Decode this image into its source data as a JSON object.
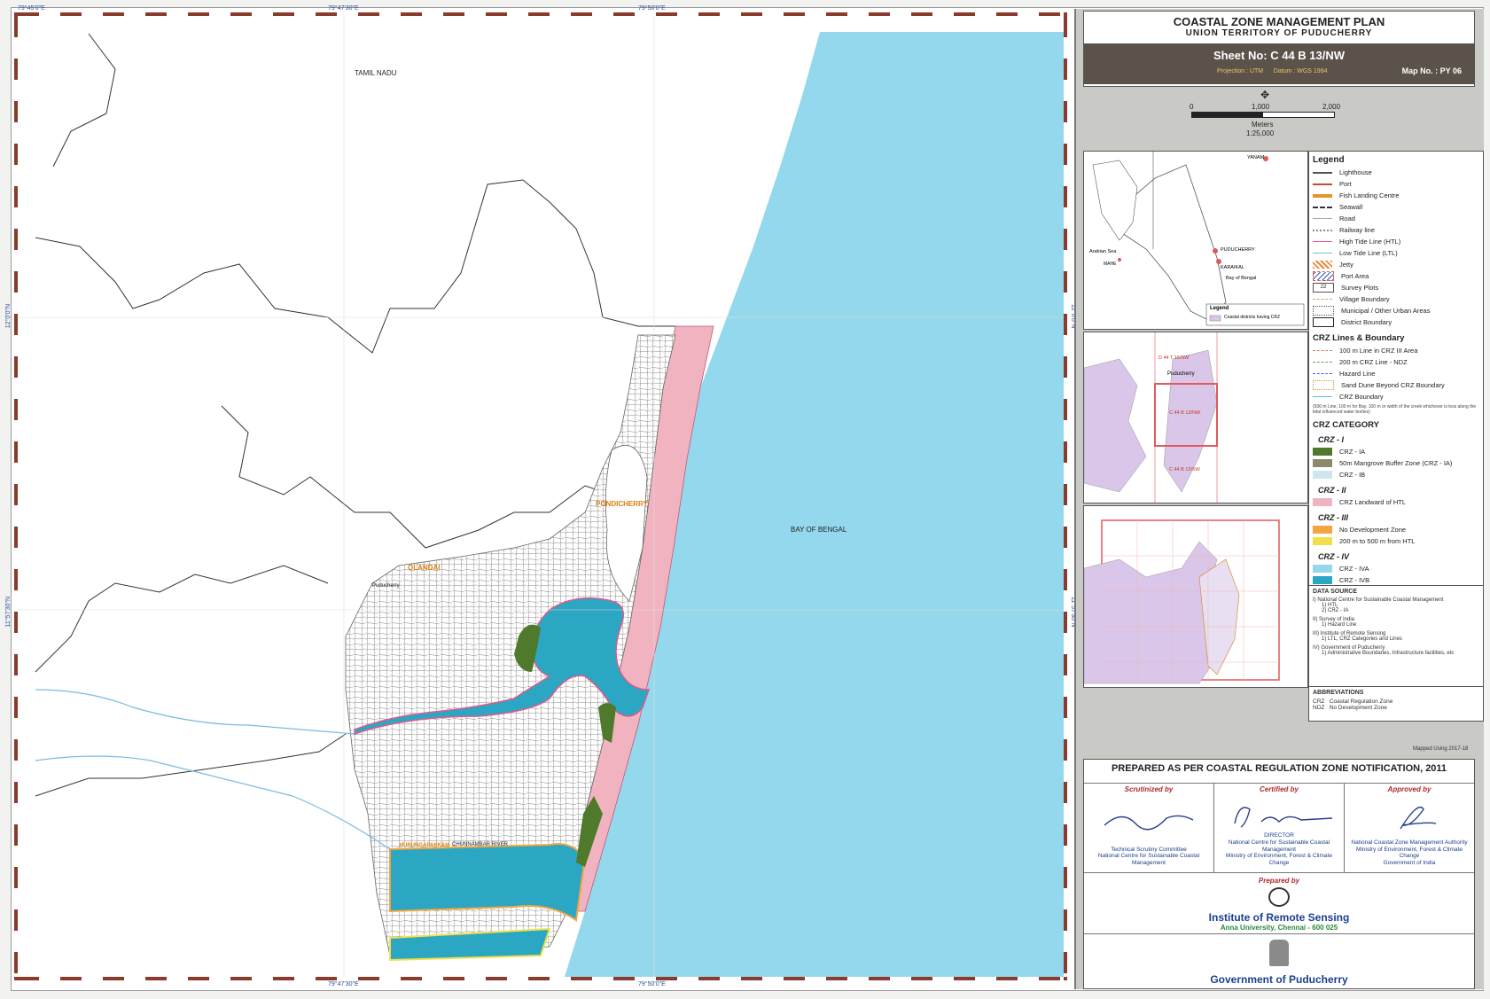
{
  "map": {
    "coords_top": [
      "79°45'0\"E",
      "79°47'30\"E",
      "79°50'0\"E"
    ],
    "coords_bottom": [
      "79°47'30\"E",
      "79°50'0\"E"
    ],
    "coords_left": [
      "12°0'0\"N",
      "11°57'30\"N"
    ],
    "coords_right": [
      "12°0'0\"N",
      "11°57'30\"N"
    ],
    "labels": {
      "tamil_nadu": "TAMIL NADU",
      "pondicherry": "PONDICHERRY",
      "olandai": "OLANDAI",
      "bay_of_bengal": "BAY OF BENGAL",
      "puducherry": "Puducherry",
      "chunnambar": "CHUNNAMBAR RIVER",
      "murungapakkam": "MURUNGAPAKKAM"
    },
    "colors": {
      "sea": "#93d8ec",
      "crz_ii": "#f2b3c0",
      "crz_iva": "#2ba7c4",
      "mangrove": "#4f7a2b",
      "village": "#777"
    }
  },
  "title": {
    "main": "COASTAL ZONE MANAGEMENT PLAN",
    "sub": "UNION TERRITORY OF PUDUCHERRY",
    "sheet": "Sheet No: C 44 B 13/NW",
    "projection": "Projection : UTM",
    "datum": "Datum : WGS 1984",
    "map_no": "Map No. : PY 06"
  },
  "scale": {
    "ticks": [
      "0",
      "1,000",
      "2,000"
    ],
    "unit": "Meters",
    "ratio": "1:25,000"
  },
  "inset1": {
    "legend_title": "Legend",
    "legend_item": "Coastal districts having CRZ",
    "labels": [
      "YANAM",
      "PUDUCHERRY",
      "KARAIKAL",
      "Arabian Sea",
      "Bay of Bengal",
      "MAHE"
    ]
  },
  "inset2": {
    "labels": [
      "D 44 T 16/SW",
      "Puducherry",
      "C 44 B 13/NW",
      "C 44 B 13/SW"
    ]
  },
  "legend": {
    "title": "Legend",
    "items": [
      {
        "label": "Lighthouse",
        "color": "#555"
      },
      {
        "label": "Port",
        "color": "#c84a2c"
      },
      {
        "label": "Fish Landing Centre",
        "color": "#e6952b"
      },
      {
        "label": "Seawall",
        "color": "#333"
      },
      {
        "label": "Road",
        "color": "#aaa"
      },
      {
        "label": "Railway line",
        "color": "#888"
      },
      {
        "label": "High Tide Line (HTL)",
        "color": "#e05a8a"
      },
      {
        "label": "Low Tide Line (LTL)",
        "color": "#7ab9e0"
      },
      {
        "label": "Jetty",
        "color": "#e88a3a"
      },
      {
        "label": "Port Area",
        "color": "#3a5ab0"
      },
      {
        "label": "Survey Plots",
        "color": "#fff"
      },
      {
        "label": "Village Boundary",
        "color": "#c9a46a"
      },
      {
        "label": "Municipal / Other Urban Areas",
        "color": "#555"
      },
      {
        "label": "District Boundary",
        "color": "#222"
      }
    ],
    "crz_lines_title": "CRZ Lines & Boundary",
    "crz_lines": [
      {
        "label": "100 m Line in CRZ III Area",
        "color": "#e07a6a"
      },
      {
        "label": "200 m CRZ Line - NDZ",
        "color": "#5aa84a"
      },
      {
        "label": "Hazard Line",
        "color": "#3a6ad0"
      },
      {
        "label": "Sand Dune Beyond CRZ Boundary",
        "color": "#b8a23a"
      },
      {
        "label": "CRZ Boundary",
        "color": "#5ac0d8"
      }
    ],
    "crz_note": "(500 m Line, 100 m for Bay, 100 m or width of the creek whichever is less along the tidal influenced water bodies)",
    "crz_category_title": "CRZ CATEGORY",
    "crz_i_title": "CRZ - I",
    "crz_i": [
      {
        "label": "CRZ - IA",
        "color": "#4f7a2b"
      },
      {
        "label": "50m Mangrove Buffer Zone (CRZ - IA)",
        "color": "#8a8a6a"
      },
      {
        "label": "CRZ - IB",
        "color": "#cfe6ef"
      }
    ],
    "crz_ii_title": "CRZ - II",
    "crz_ii": [
      {
        "label": "CRZ Landward of HTL",
        "color": "#f2b3c0"
      }
    ],
    "crz_iii_title": "CRZ - III",
    "crz_iii": [
      {
        "label": "No Development Zone",
        "color": "#f2a640"
      },
      {
        "label": "200 m to 500 m from HTL",
        "color": "#f2e04a"
      }
    ],
    "crz_iv_title": "CRZ - IV",
    "crz_iv": [
      {
        "label": "CRZ - IVA",
        "color": "#93d8ec"
      },
      {
        "label": "CRZ - IVB",
        "color": "#2ba7c4"
      }
    ]
  },
  "data_source": {
    "title": "DATA SOURCE",
    "lines": [
      "I) National Centre for Sustainable Coastal Management",
      "1) HTL",
      "2) CRZ - IA",
      "II) Survey of India",
      "1) Hazard Line",
      "III) Institute of Remote Sensing",
      "1) LTL, CRZ Categories and Lines",
      "IV) Government of Puducherry",
      "1) Administrative Boundaries, Infrastructure facilities, etc"
    ]
  },
  "abbreviations": {
    "title": "ABBREVIATIONS",
    "items": [
      {
        "abbr": "CRZ",
        "full": "Coastal Regulation Zone"
      },
      {
        "abbr": "NDZ",
        "full": "No Development Zone"
      }
    ]
  },
  "mapped_using": "Mapped Using 2017-18",
  "prepared": {
    "title": "PREPARED AS PER COASTAL REGULATION ZONE NOTIFICATION, 2011",
    "scrutinized": {
      "head": "Scrutinized by",
      "line1": "Technical Scrutiny Committee",
      "line2": "National Centre for Sustainable Coastal Management"
    },
    "certified": {
      "head": "Certified by",
      "line1": "DIRECTOR",
      "line2": "National Centre for Sustainable Coastal Management",
      "line3": "Ministry of Environment, Forest & Climate Change"
    },
    "approved": {
      "head": "Approved by",
      "line1": "National Coastal Zone Management Authority",
      "line2": "Ministry of Environment, Forest & Climate Change",
      "line3": "Government of India"
    },
    "prepared_by": "Prepared by",
    "institute": "Institute of Remote Sensing",
    "address": "Anna University, Chennai - 600 025",
    "government": "Government of Puducherry"
  }
}
